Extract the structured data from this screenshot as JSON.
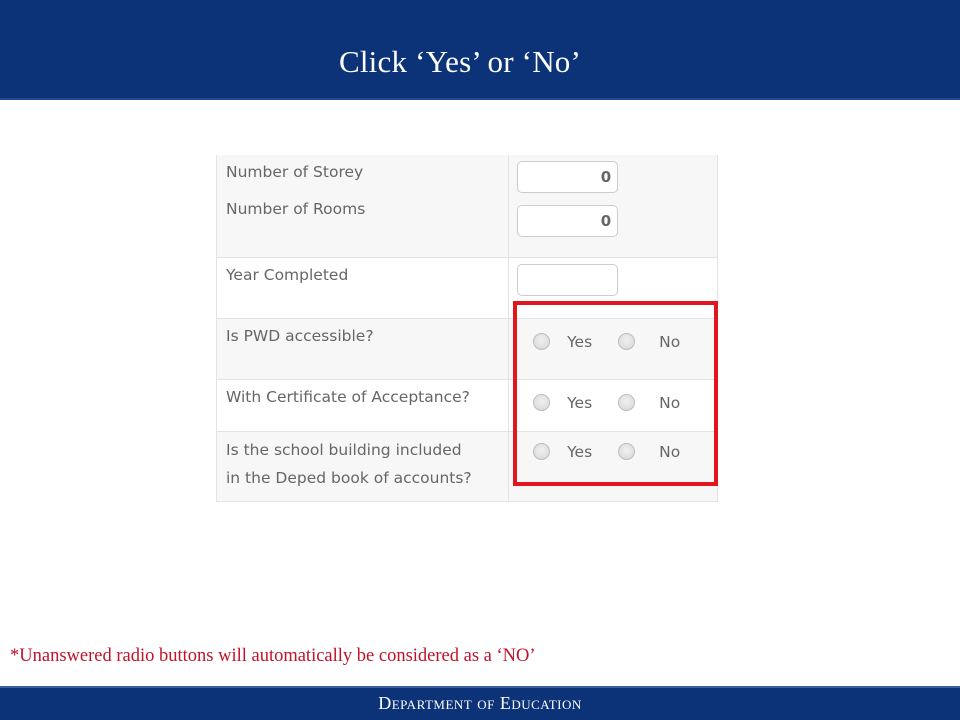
{
  "header": {
    "title": "Click ‘Yes’ or ‘No’"
  },
  "form": {
    "storey_label": "Number of Storey",
    "storey_value": "0",
    "rooms_label": "Number of Rooms",
    "rooms_value": "0",
    "year_label": "Year Completed",
    "year_value": "",
    "questions": [
      {
        "label_line1": "Is PWD accessible?",
        "label_line2": "",
        "yes": "Yes",
        "no": "No",
        "selected": null
      },
      {
        "label_line1": "With Certificate of Acceptance?",
        "label_line2": "",
        "yes": "Yes",
        "no": "No",
        "selected": null
      },
      {
        "label_line1": "Is the school building included",
        "label_line2": "in the Deped book of accounts?",
        "yes": "Yes",
        "no": "No",
        "selected": null
      }
    ]
  },
  "annotation": {
    "highlight_color": "#e0171f"
  },
  "footnote": "*Unanswered radio buttons will automatically be considered as a ‘NO’",
  "footer": {
    "text": "Department of Education"
  },
  "colors": {
    "brand_blue": "#0c3378",
    "footnote_red": "#c0122a"
  }
}
